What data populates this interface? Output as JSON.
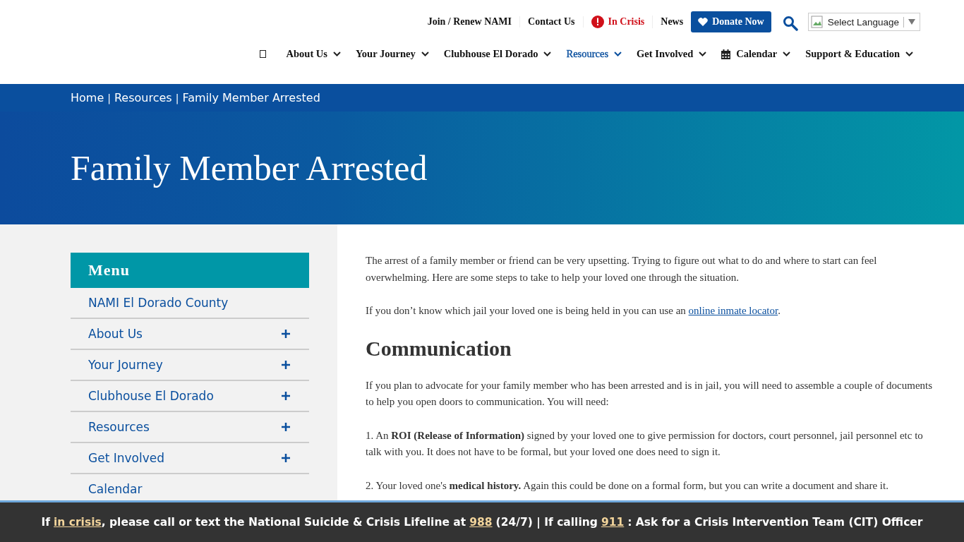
{
  "top_links": [
    {
      "label": "Join / Renew NAMI",
      "kind": "link"
    },
    {
      "label": "Contact Us",
      "kind": "link"
    },
    {
      "label": "In Crisis",
      "kind": "alert"
    },
    {
      "label": "News",
      "kind": "link"
    }
  ],
  "donate_button": "Donate Now",
  "language_select": "Select Language",
  "nav": [
    {
      "label": "About Us",
      "selected": false,
      "kind": "text"
    },
    {
      "label": "Your Journey",
      "selected": false,
      "kind": "text"
    },
    {
      "label": "Clubhouse El Dorado",
      "selected": false,
      "kind": "text"
    },
    {
      "label": "Resources",
      "selected": true,
      "kind": "text"
    },
    {
      "label": "Get Involved",
      "selected": false,
      "kind": "text"
    },
    {
      "label": "Calendar",
      "selected": false,
      "kind": "calendar"
    },
    {
      "label": "Support & Education",
      "selected": false,
      "kind": "text"
    }
  ],
  "breadcrumb": [
    {
      "label": "Home"
    },
    {
      "separator": "|",
      "label": "Resources"
    },
    {
      "separator": "|",
      "label": "Family Member Arrested"
    }
  ],
  "page_title": "Family Member Arrested",
  "sidebar": {
    "title": "Menu",
    "items": [
      {
        "label": "NAMI El Dorado County",
        "expandable": false
      },
      {
        "label": "About Us",
        "expandable": true
      },
      {
        "label": "Your Journey",
        "expandable": true
      },
      {
        "label": "Clubhouse El Dorado",
        "expandable": true
      },
      {
        "label": "Resources",
        "expandable": true
      },
      {
        "label": "Get Involved",
        "expandable": true
      },
      {
        "label": "Calendar",
        "expandable": false
      }
    ]
  },
  "content": [
    {
      "kind": "paragraph",
      "text": "The arrest of a family member or friend can be very upsetting. Trying to figure out what to do and where to start can feel overwhelming. Here are some steps to take to help your loved one through the situation."
    },
    {
      "kind": "link_paragraph",
      "text": "If you don’t know which jail your loved one is being held in you can use an",
      "link": "online inmate locator",
      "after": "."
    },
    {
      "kind": "heading",
      "text": "Communication"
    },
    {
      "kind": "paragraph",
      "text": "If you plan to advocate for your family member who has been arrested and is in jail, you will need to assemble a couple of documents to help you open doors to communication. You will need:"
    },
    {
      "kind": "paragraph",
      "text": "1. An **ROI (Release of Information)**  signed by your loved one to give permission for doctors, court personnel, jail personnel etc to talk with you. It does not have to be formal, but your loved one does need to sign it."
    },
    {
      "kind": "paragraph",
      "text": "2. Your loved one's **medical history.** Again this could be done on a formal form, but you can write a document and share it."
    }
  ],
  "crisis_bar": [
    {
      "kind": "text",
      "text": "If"
    },
    {
      "kind": "link",
      "text": "in crisis"
    },
    {
      "kind": "text",
      "text": ", please call or text the National Suicide & Crisis Lifeline at"
    },
    {
      "kind": "link",
      "text": "988"
    },
    {
      "kind": "text",
      "text": "(24/7) | If calling"
    },
    {
      "kind": "link",
      "text": "911"
    },
    {
      "kind": "text",
      "text": ": Ask for a Crisis Intervention Team (CIT) Officer"
    }
  ]
}
